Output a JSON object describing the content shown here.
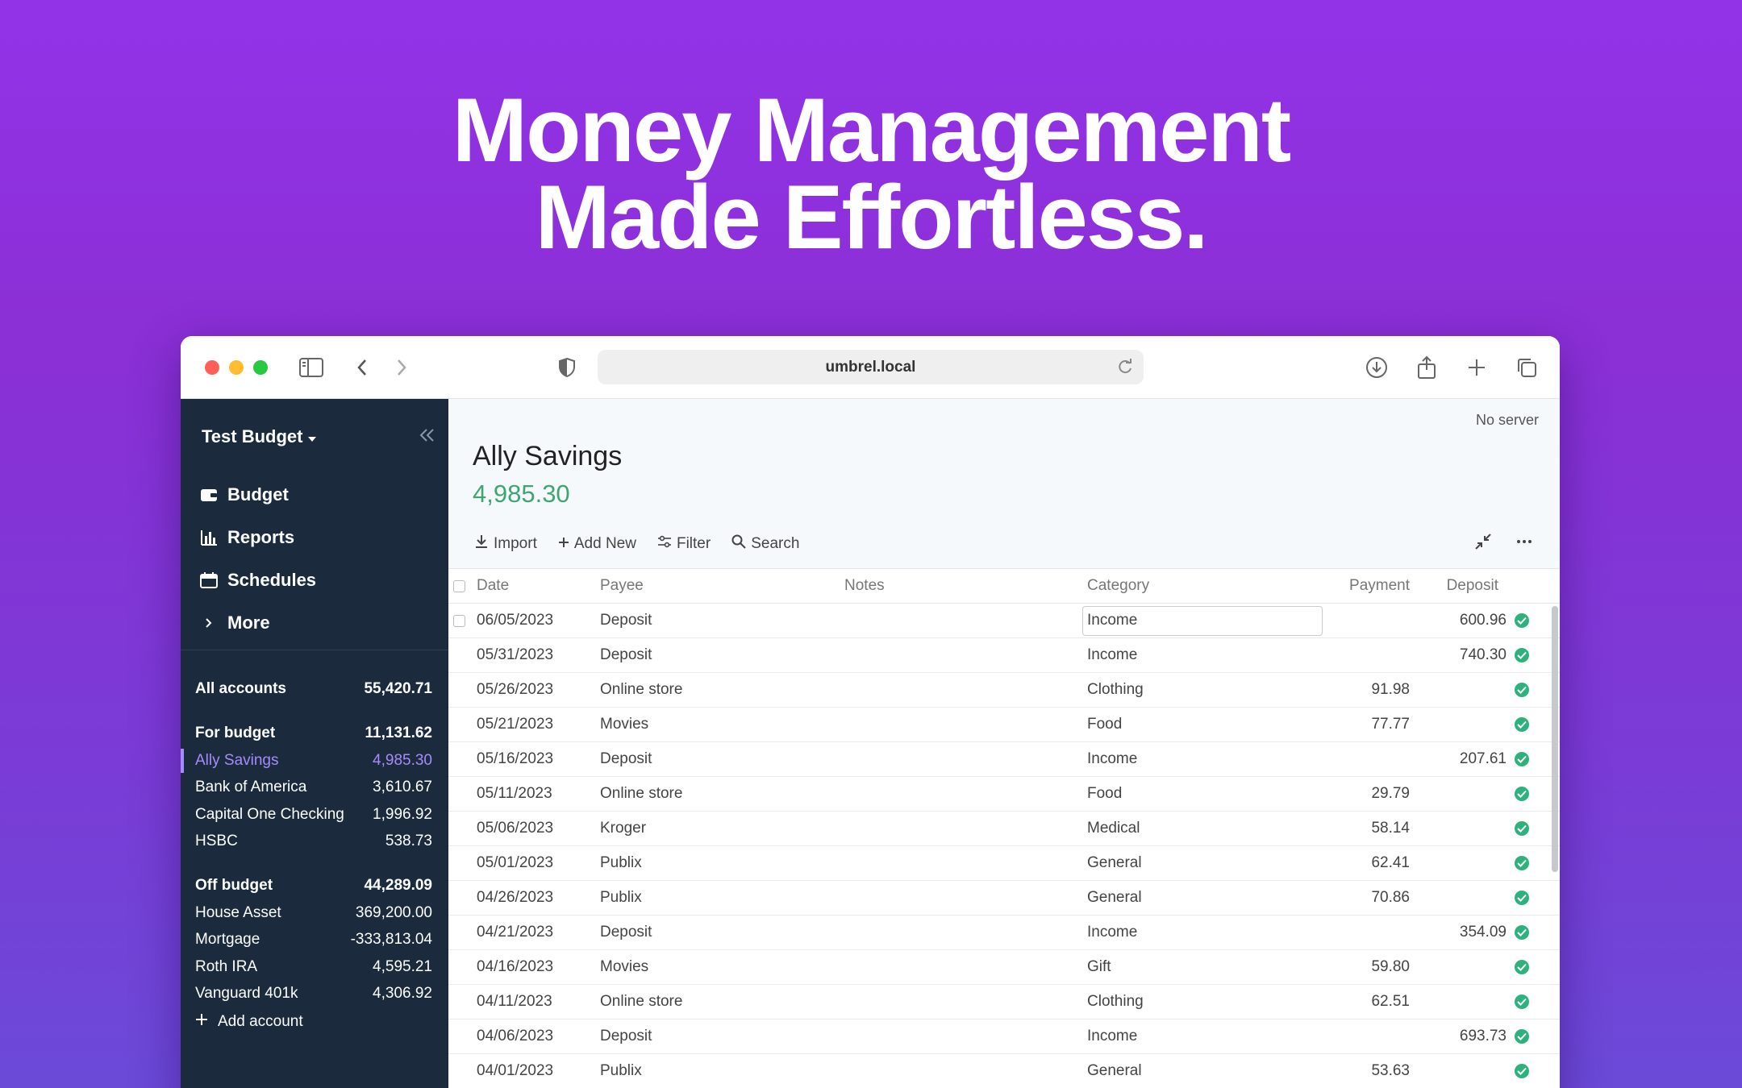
{
  "headline": {
    "line1": "Money Management",
    "line2": "Made Effortless."
  },
  "browser": {
    "url": "umbrel.local"
  },
  "sidebar": {
    "budget_name": "Test Budget",
    "nav": [
      {
        "label": "Budget",
        "icon": "wallet-icon"
      },
      {
        "label": "Reports",
        "icon": "bar-chart-icon"
      },
      {
        "label": "Schedules",
        "icon": "calendar-icon"
      },
      {
        "label": "More",
        "icon": "chevron-right-icon"
      }
    ],
    "all_accounts": {
      "label": "All accounts",
      "value": "55,420.71"
    },
    "for_budget": {
      "label": "For budget",
      "value": "11,131.62"
    },
    "budget_accounts": [
      {
        "label": "Ally Savings",
        "value": "4,985.30"
      },
      {
        "label": "Bank of America",
        "value": "3,610.67"
      },
      {
        "label": "Capital One Checking",
        "value": "1,996.92"
      },
      {
        "label": "HSBC",
        "value": "538.73"
      }
    ],
    "off_budget": {
      "label": "Off budget",
      "value": "44,289.09"
    },
    "off_budget_accounts": [
      {
        "label": "House Asset",
        "value": "369,200.00"
      },
      {
        "label": "Mortgage",
        "value": "-333,813.04"
      },
      {
        "label": "Roth IRA",
        "value": "4,595.21"
      },
      {
        "label": "Vanguard 401k",
        "value": "4,306.92"
      }
    ],
    "add_account": "Add account"
  },
  "main": {
    "no_server": "No server",
    "account_title": "Ally Savings",
    "account_balance": "4,985.30",
    "actions": {
      "import": "Import",
      "add_new": "Add New",
      "filter": "Filter",
      "search": "Search"
    },
    "columns": {
      "date": "Date",
      "payee": "Payee",
      "notes": "Notes",
      "category": "Category",
      "payment": "Payment",
      "deposit": "Deposit"
    },
    "rows": [
      {
        "date": "06/05/2023",
        "payee": "Deposit",
        "category": "Income",
        "payment": "",
        "deposit": "600.96"
      },
      {
        "date": "05/31/2023",
        "payee": "Deposit",
        "category": "Income",
        "payment": "",
        "deposit": "740.30"
      },
      {
        "date": "05/26/2023",
        "payee": "Online store",
        "category": "Clothing",
        "payment": "91.98",
        "deposit": ""
      },
      {
        "date": "05/21/2023",
        "payee": "Movies",
        "category": "Food",
        "payment": "77.77",
        "deposit": ""
      },
      {
        "date": "05/16/2023",
        "payee": "Deposit",
        "category": "Income",
        "payment": "",
        "deposit": "207.61"
      },
      {
        "date": "05/11/2023",
        "payee": "Online store",
        "category": "Food",
        "payment": "29.79",
        "deposit": ""
      },
      {
        "date": "05/06/2023",
        "payee": "Kroger",
        "category": "Medical",
        "payment": "58.14",
        "deposit": ""
      },
      {
        "date": "05/01/2023",
        "payee": "Publix",
        "category": "General",
        "payment": "62.41",
        "deposit": ""
      },
      {
        "date": "04/26/2023",
        "payee": "Publix",
        "category": "General",
        "payment": "70.86",
        "deposit": ""
      },
      {
        "date": "04/21/2023",
        "payee": "Deposit",
        "category": "Income",
        "payment": "",
        "deposit": "354.09"
      },
      {
        "date": "04/16/2023",
        "payee": "Movies",
        "category": "Gift",
        "payment": "59.80",
        "deposit": ""
      },
      {
        "date": "04/11/2023",
        "payee": "Online store",
        "category": "Clothing",
        "payment": "62.51",
        "deposit": ""
      },
      {
        "date": "04/06/2023",
        "payee": "Deposit",
        "category": "Income",
        "payment": "",
        "deposit": "693.73"
      },
      {
        "date": "04/01/2023",
        "payee": "Publix",
        "category": "General",
        "payment": "53.63",
        "deposit": ""
      }
    ]
  },
  "colors": {
    "accent": "#a78bfa",
    "balance": "#3fa672",
    "sidebar_bg": "#1b2b3d",
    "cleared": "#2db27d"
  }
}
